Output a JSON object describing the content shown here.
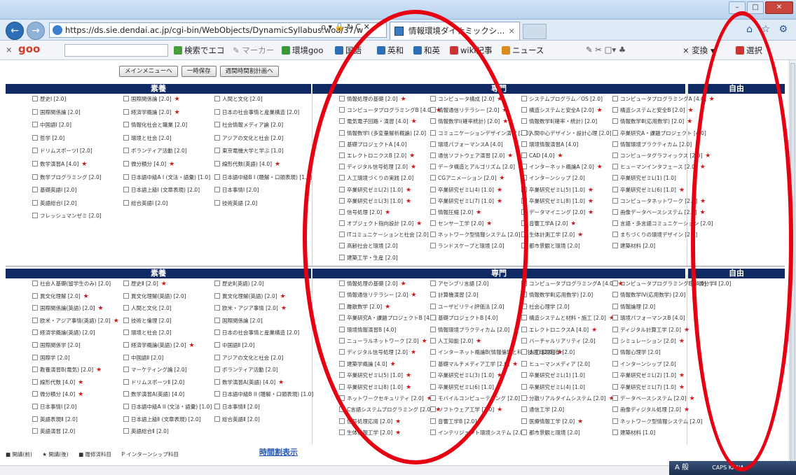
{
  "browser": {
    "url": "https://ds.sie.dendai.ac.jp/cgi-bin/WebObjects/DynamicSyllabus.woa/37/w",
    "addr_icons": "ρ ▾ 🔒 ↻ C ✕",
    "tab_title": "情報環境ダイナミックシ...",
    "tab_close": "×",
    "back_icon": "←",
    "fwd_icon": "→",
    "right_icons": "⌂ ☆ ⚙"
  },
  "toolbar": {
    "close": "×",
    "logo": "goo",
    "search_btn": "検索でエコ",
    "marker": "マーカー",
    "env_goo": "環境goo",
    "kokugo": "国語",
    "eiwa": "英和",
    "waei": "和英",
    "wiki": "wiki記事",
    "news": "ニュース",
    "henkan": "変換",
    "sentaku": "選択"
  },
  "page": {
    "buttons": [
      "メインメニューへ",
      "一時保存",
      "週間時間割計画へ"
    ],
    "headers_top": [
      "素養",
      "専門",
      "自由"
    ],
    "headers_bottom": [
      "素養",
      "専門",
      "自由"
    ],
    "legend": [
      "■ 開講(前)",
      "★ 開講(後)",
      "■ 履修済科目",
      "P インターンシップ科目"
    ],
    "jikan_link": "時間割表示"
  },
  "top": {
    "soyo": [
      [
        {
          "t": "歴史Ⅰ [2.0]",
          "s": false
        },
        {
          "t": "国際関係論 [2.0]",
          "s": false
        },
        {
          "t": "中国語Ⅰ [2.0]",
          "s": false
        },
        {
          "t": "哲学 [2.0]",
          "s": false
        },
        {
          "t": "ドリムスポーツⅠ [2.0]",
          "s": false
        },
        {
          "t": "数学演習A [4.0]",
          "s": true
        },
        {
          "t": "数学プログラミング [2.0]",
          "s": false
        },
        {
          "t": "基礎英語Ⅰ [2.0]",
          "s": false
        },
        {
          "t": "英語総合Ⅰ [2.0]",
          "s": false
        },
        {
          "t": "フレッシュマンゼミ [2.0]",
          "s": false
        }
      ],
      [
        {
          "t": "国際関係論 [2.0]",
          "s": true
        },
        {
          "t": "経済学概論 [2.0]",
          "s": true
        },
        {
          "t": "情報化社会と職業 [2.0]",
          "s": false
        },
        {
          "t": "環境と社会 [2.0]",
          "s": false
        },
        {
          "t": "ボランティア活動 [2.0]",
          "s": false
        },
        {
          "t": "微分積分 [4.0]",
          "s": true
        },
        {
          "t": "日本語中級A I (文法・語彙) [1.0]",
          "s": false
        },
        {
          "t": "日本語上級Ⅰ (文章表現) [2.0]",
          "s": false
        },
        {
          "t": "総合英語Ⅰ [2.0]",
          "s": false
        }
      ],
      [
        {
          "t": "人間と文化 [2.0]",
          "s": false
        },
        {
          "t": "日本の社会事情と産業構造 [2.0]",
          "s": false
        },
        {
          "t": "社会情報メディア論 [2.0]",
          "s": false
        },
        {
          "t": "アジアの文化と社会 [2.0]",
          "s": false
        },
        {
          "t": "東京電機大学と学ぶ [1.0]",
          "s": false
        },
        {
          "t": "線形代数(英語) [4.0]",
          "s": true
        },
        {
          "t": "日本語中級B I (聴解・口頭表現) [1.0]",
          "s": false
        },
        {
          "t": "日本事情Ⅰ [2.0]",
          "s": false
        },
        {
          "t": "技術英語 [2.0]",
          "s": false
        }
      ]
    ],
    "senmon": [
      [
        {
          "t": "情報処理の基礎 [2.0]",
          "s": true
        },
        {
          "t": "コンピュータプログラミングB [4.0]",
          "s": true
        },
        {
          "t": "電気電子回路・演習 [4.0]",
          "s": true
        },
        {
          "t": "情報数学I (多変量解析概論) [2.0]",
          "s": false
        },
        {
          "t": "基礎プロジェクトA [4.0]",
          "s": false
        },
        {
          "t": "エレクトロニクスB [2.0]",
          "s": true
        },
        {
          "t": "ディジタル信号処理 [2.0]",
          "s": true
        },
        {
          "t": "人工環境づくりの実践 [2.0]",
          "s": false
        },
        {
          "t": "卒業研究ゼミL(2) [1.0]",
          "s": true
        },
        {
          "t": "卒業研究ゼミL(3) [1.0]",
          "s": true
        },
        {
          "t": "信号処理 [2.0]",
          "s": true
        },
        {
          "t": "オブジェクト指向設計 [2.0]",
          "s": true
        },
        {
          "t": "ITコミュニケーションと社会 [2.0]",
          "s": false
        },
        {
          "t": "高齢社会と環境 [2.0]",
          "s": false
        },
        {
          "t": "建築工学・生産 [2.0]",
          "s": false
        }
      ],
      [
        {
          "t": "コンピュータ構成 [2.0]",
          "s": true
        },
        {
          "t": "情報通信リテラシー [2.0]",
          "s": true
        },
        {
          "t": "情報数学Ⅰ(確率統計) [2.0]",
          "s": true
        },
        {
          "t": "コミュニケーションデザイン演習 [2.0]",
          "s": false
        },
        {
          "t": "環境パフォーマンスA [4.0]",
          "s": false
        },
        {
          "t": "通信ソフトウェア演習 [2.0]",
          "s": true
        },
        {
          "t": "データ構造とアルゴリズム [2.0]",
          "s": true
        },
        {
          "t": "CGアニメーション [2.0]",
          "s": true
        },
        {
          "t": "卒業研究ゼミL(4) [1.0]",
          "s": true
        },
        {
          "t": "卒業研究ゼミL(7) [1.0]",
          "s": true
        },
        {
          "t": "情報圧縮 [2.0]",
          "s": true
        },
        {
          "t": "センサー工学 [2.0]",
          "s": true
        },
        {
          "t": "ネットワーク型情報システム [2.0]",
          "s": false
        },
        {
          "t": "ランドスケープと環境 [2.0]",
          "s": false
        }
      ],
      [
        {
          "t": "システムプログラム／OS [2.0]",
          "s": false
        },
        {
          "t": "構造システムと安全A [2.0]",
          "s": true
        },
        {
          "t": "情報数学Ⅱ(確率・統計) [2.0]",
          "s": false
        },
        {
          "t": "人間中心デザイン・設計心理 [2.0]",
          "s": false
        },
        {
          "t": "環境情報演習A [4.0]",
          "s": false
        },
        {
          "t": "CAD [4.0]",
          "s": true
        },
        {
          "t": "インターネット概論A [2.0]",
          "s": true
        },
        {
          "t": "インターンシップ [2.0]",
          "s": false
        },
        {
          "t": "卒業研究ゼミL(5) [1.0]",
          "s": true
        },
        {
          "t": "卒業研究ゼミL(8) [1.0]",
          "s": true
        },
        {
          "t": "データマイニング [2.0]",
          "s": true
        },
        {
          "t": "音響工学A [2.0]",
          "s": true
        },
        {
          "t": "生体計測工学 [2.0]",
          "s": true
        },
        {
          "t": "都市景観と環境 [2.0]",
          "s": false
        }
      ],
      [
        {
          "t": "コンピュータプログラミングA [4.0]",
          "s": true
        },
        {
          "t": "構造システムと安全B [2.0]",
          "s": true
        },
        {
          "t": "情報数学Ⅲ(応用数学) [2.0]",
          "s": true
        },
        {
          "t": "卒業研究A・課題プロジェクト [4.0]",
          "s": false
        },
        {
          "t": "情報環境プラクティカム [2.0]",
          "s": false
        },
        {
          "t": "コンピュータグラフィックス [2.0]",
          "s": true
        },
        {
          "t": "ヒューマンインタフェース [2.0]",
          "s": true
        },
        {
          "t": "卒業研究ゼミL(1) [1.0]",
          "s": false
        },
        {
          "t": "卒業研究ゼミL(6) [1.0]",
          "s": true
        },
        {
          "t": "コンピュータネットワーク [2.0]",
          "s": true
        },
        {
          "t": "画像データベースシステム [2.0]",
          "s": true
        },
        {
          "t": "言語・多言語コミュニケーション [2.0]",
          "s": false
        },
        {
          "t": "まちづくりの環境デザイン [2.0]",
          "s": false
        },
        {
          "t": "建築材料 [2.0]",
          "s": false
        }
      ]
    ]
  },
  "bottom": {
    "soyo": [
      [
        {
          "t": "社会人基礎(留学生のみ) [2.0]",
          "s": false
        },
        {
          "t": "異文化理解 [2.0]",
          "s": true
        },
        {
          "t": "国際関係論(英語) [2.0]",
          "s": true
        },
        {
          "t": "欧米・アジア事情(英語) [2.0]",
          "s": true
        },
        {
          "t": "経済学概論(英語) [2.0]",
          "s": false
        },
        {
          "t": "国際関係学 [2.0]",
          "s": false
        },
        {
          "t": "国際学 [2.0]",
          "s": false
        },
        {
          "t": "教養演習B(電気) [2.0]",
          "s": true
        },
        {
          "t": "線形代数 [4.0]",
          "s": true
        },
        {
          "t": "微分積分 [4.0]",
          "s": true
        },
        {
          "t": "日本事情Ⅰ [2.0]",
          "s": false
        },
        {
          "t": "英語表現Ⅱ [2.0]",
          "s": false
        },
        {
          "t": "英語演習 [2.0]",
          "s": false
        }
      ],
      [
        {
          "t": "歴史Ⅱ [2.0]",
          "s": true
        },
        {
          "t": "異文化理解(英語) [2.0]",
          "s": false
        },
        {
          "t": "人間と文化 [2.0]",
          "s": false
        },
        {
          "t": "技術と倫理 [2.0]",
          "s": false
        },
        {
          "t": "環境と社会 [2.0]",
          "s": false
        },
        {
          "t": "経済学概論(英語) [2.0]",
          "s": true
        },
        {
          "t": "中国語Ⅱ [2.0]",
          "s": false
        },
        {
          "t": "マーケティング論 [2.0]",
          "s": false
        },
        {
          "t": "ドリムスポーツⅡ [2.0]",
          "s": false
        },
        {
          "t": "数学演習A(英語) [4.0]",
          "s": false
        },
        {
          "t": "日本語中級A II (文法・語彙) [1.0]",
          "s": false
        },
        {
          "t": "日本語上級Ⅱ (文章表現) [2.0]",
          "s": false
        },
        {
          "t": "英語総合Ⅱ [2.0]",
          "s": false
        }
      ],
      [
        {
          "t": "歴史Ⅱ(英語) [2.0]",
          "s": false
        },
        {
          "t": "異文化理解(英語) [2.0]",
          "s": true
        },
        {
          "t": "欧米・アジア事情 [2.0]",
          "s": true
        },
        {
          "t": "国際関係論 [2.0]",
          "s": false
        },
        {
          "t": "日本の社会事情と産業構造 [2.0]",
          "s": false
        },
        {
          "t": "中国語Ⅱ [2.0]",
          "s": false
        },
        {
          "t": "アジアの文化と社会 [2.0]",
          "s": false
        },
        {
          "t": "ボランティア活動 [2.0]",
          "s": false
        },
        {
          "t": "数学演習A(英語) [4.0]",
          "s": true
        },
        {
          "t": "日本語中級B II (聴解・口頭表現) [1.0]",
          "s": false
        },
        {
          "t": "日本事情Ⅱ [2.0]",
          "s": false
        },
        {
          "t": "総合英語Ⅱ [2.0]",
          "s": false
        }
      ]
    ],
    "senmon": [
      [
        {
          "t": "情報処理の基礎 [2.0]",
          "s": true
        },
        {
          "t": "情報通信リテラシー [2.0]",
          "s": true
        },
        {
          "t": "離散数学 [2.0]",
          "s": true
        },
        {
          "t": "卒業研究A・課題プロジェクトB [4.0]",
          "s": false
        },
        {
          "t": "環境情報演習B [4.0]",
          "s": false
        },
        {
          "t": "ニューラルネットワーク [2.0]",
          "s": true
        },
        {
          "t": "ディジタル信号処理 [2.0]",
          "s": true
        },
        {
          "t": "建築学概論 [4.0]",
          "s": true
        },
        {
          "t": "卒業研究ゼミL(5) [1.0]",
          "s": true
        },
        {
          "t": "卒業研究ゼミL(8) [1.0]",
          "s": true
        },
        {
          "t": "ネットワークセキュリティ [2.0]",
          "s": true
        },
        {
          "t": "C言語システムプログラミング [2.0]",
          "s": true
        },
        {
          "t": "信号処理応用 [2.0]",
          "s": true
        },
        {
          "t": "生体情報工学 [2.0]",
          "s": true
        }
      ],
      [
        {
          "t": "アセンブリ言語 [2.0]",
          "s": false
        },
        {
          "t": "計算機演習 [2.0]",
          "s": false
        },
        {
          "t": "ユーザビリティ評価法 [2.0]",
          "s": false
        },
        {
          "t": "基礎プロジェクトB [4.0]",
          "s": false
        },
        {
          "t": "情報環境プラクティカム [2.0]",
          "s": false
        },
        {
          "t": "人工知能 [2.0]",
          "s": true
        },
        {
          "t": "インターネット概論B(情報倫理と科学技術) [2.0]",
          "s": true
        },
        {
          "t": "基礎マルチメディア工学 [2.0]",
          "s": true
        },
        {
          "t": "卒業研究ゼミL(3) [1.0]",
          "s": true
        },
        {
          "t": "卒業研究ゼミL(6) [1.0]",
          "s": false
        },
        {
          "t": "モバイルコンピューティング [2.0]",
          "s": true
        },
        {
          "t": "ソフトウェア工学 [2.0]",
          "s": true
        },
        {
          "t": "音響工学B [2.0]",
          "s": false
        },
        {
          "t": "インテリジェント環境システム [2.0]",
          "s": false
        }
      ],
      [
        {
          "t": "コンピュータプログラミングA [4.0]",
          "s": true
        },
        {
          "t": "情報数学Ⅲ(応用数学) [2.0]",
          "s": false
        },
        {
          "t": "社会心理学 [2.0]",
          "s": false
        },
        {
          "t": "構造システムと材料・施工 [2.0]",
          "s": true
        },
        {
          "t": "エレクトロニクスA [4.0]",
          "s": true
        },
        {
          "t": "バーチャルリアリティ [2.0]",
          "s": false
        },
        {
          "t": "人工環境制御 [2.0]",
          "s": false
        },
        {
          "t": "ヒューマンメディア [2.0]",
          "s": false
        },
        {
          "t": "卒業研究ゼミL(1) [1.0]",
          "s": false
        },
        {
          "t": "卒業研究ゼミL(4) [1.0]",
          "s": false
        },
        {
          "t": "分散リアルタイムシステム [2.0]",
          "s": true
        },
        {
          "t": "通信工学 [2.0]",
          "s": false
        },
        {
          "t": "医療情報工学 [2.0]",
          "s": true
        },
        {
          "t": "都市景観と環境 [2.0]",
          "s": false
        }
      ],
      [
        {
          "t": "コンピュータプログラミングB [4.0]",
          "s": false
        },
        {
          "t": "情報数学IV(応用数学) [2.0]",
          "s": false
        },
        {
          "t": "情報論理 [2.0]",
          "s": false
        },
        {
          "t": "環境パフォーマンスB [4.0]",
          "s": false
        },
        {
          "t": "ディジタル計算工学 [2.0]",
          "s": true
        },
        {
          "t": "シミュレーション [2.0]",
          "s": true
        },
        {
          "t": "情報心理学 [2.0]",
          "s": false
        },
        {
          "t": "インターンシップ [2.0]",
          "s": false
        },
        {
          "t": "卒業研究ゼミL(2) [1.0]",
          "s": true
        },
        {
          "t": "卒業研究ゼミL(7) [1.0]",
          "s": true
        },
        {
          "t": "データベースシステム [2.0]",
          "s": true
        },
        {
          "t": "画像ディジタル処理 [2.0]",
          "s": true
        },
        {
          "t": "ネットワーク型情報システム [2.0]",
          "s": false
        },
        {
          "t": "建築材料 [1.0]",
          "s": false
        }
      ]
    ],
    "jiyu": [
      {
        "t": "微分学Ⅱ [2.0]",
        "s": false
      }
    ]
  },
  "taskbar": {
    "ime": "A 般",
    "lang": "CAPS KANA"
  }
}
